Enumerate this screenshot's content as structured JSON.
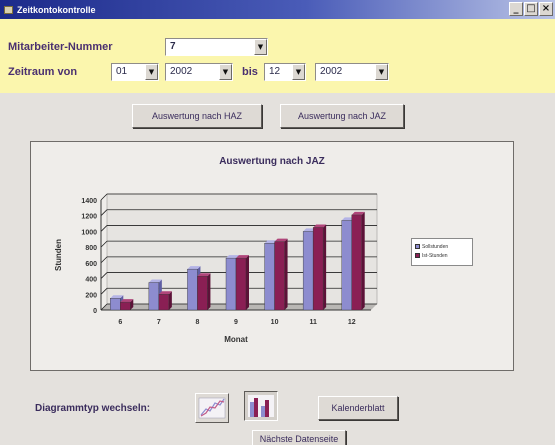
{
  "window": {
    "title": "Zeitkontokontrolle",
    "controls": {
      "minimize": "_",
      "maximize": "□",
      "close": "×"
    }
  },
  "filters": {
    "employee_label": "Mitarbeiter-Nummer",
    "employee_value": "7",
    "period_label": "Zeitraum von",
    "from_month": "01",
    "from_year": "2002",
    "to_label": "bis",
    "to_month": "12",
    "to_year": "2002"
  },
  "actions": {
    "haz_label": "Auswertung nach HAZ",
    "jaz_label": "Auswertung nach JAZ"
  },
  "chart_data": {
    "type": "bar",
    "title": "Auswertung nach JAZ",
    "xlabel": "Monat",
    "ylabel": "Stunden",
    "ylim": [
      0,
      1400
    ],
    "yticks": [
      0,
      200,
      400,
      600,
      800,
      1000,
      1200,
      1400
    ],
    "categories": [
      "6",
      "7",
      "8",
      "9",
      "10",
      "11",
      "12"
    ],
    "series": [
      {
        "name": "Sollstunden",
        "color": "#8d8ccf",
        "values": [
          150,
          350,
          520,
          660,
          850,
          1000,
          1140
        ]
      },
      {
        "name": "Ist-Stunden",
        "color": "#8a1f54",
        "values": [
          100,
          200,
          430,
          660,
          870,
          1050,
          1210
        ]
      }
    ],
    "legend_position": "right",
    "grid": true
  },
  "bottom": {
    "chart_type_label": "Diagrammtyp wechseln:",
    "calendar_label": "Kalenderblatt",
    "next_page_label": "Nächste Datenseite"
  },
  "colors": {
    "titlebar": "#1c2a8a",
    "filter_bg": "#fbf6ad",
    "series_1": "#8d8ccf",
    "series_2": "#8a1f54"
  }
}
